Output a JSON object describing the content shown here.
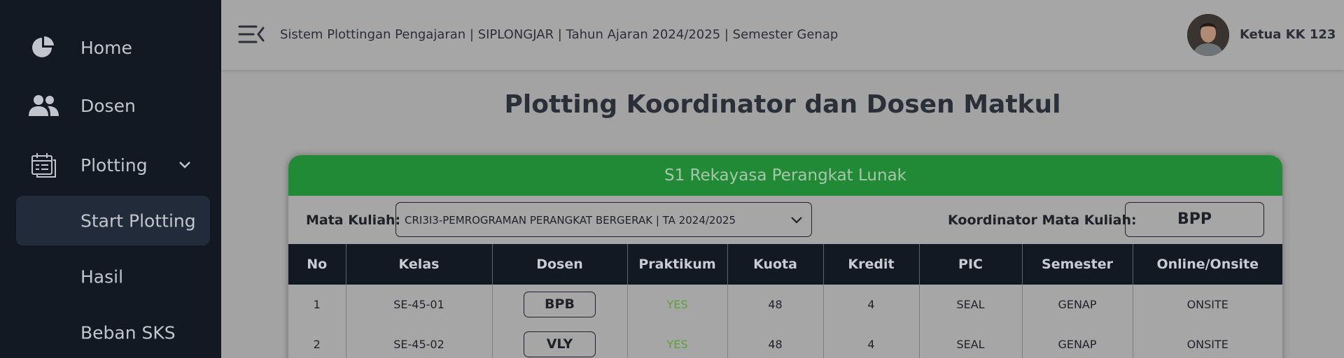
{
  "sidebar": {
    "items": [
      {
        "label": "Home",
        "icon": "pie-chart-icon"
      },
      {
        "label": "Dosen",
        "icon": "users-icon"
      },
      {
        "label": "Plotting",
        "icon": "calendar-list-icon"
      }
    ],
    "sub_items": [
      {
        "label": "Start Plotting",
        "active": true
      },
      {
        "label": "Hasil"
      },
      {
        "label": "Beban SKS"
      }
    ]
  },
  "topbar": {
    "title": "Sistem Plottingan Pengajaran | SIPLONGJAR | Tahun Ajaran 2024/2025 | Semester Genap",
    "user_name": "Ketua KK 123"
  },
  "page": {
    "title": "Plotting Koordinator dan Dosen Matkul"
  },
  "card": {
    "header": "S1 Rekayasa Perangkat Lunak",
    "mata_kuliah_label": "Mata Kuliah:",
    "mata_kuliah_value": "CRI3I3-PEMROGRAMAN PERANGKAT BERGERAK | TA 2024/2025",
    "koordinator_label": "Koordinator Mata Kuliah:",
    "koordinator_value": "BPP"
  },
  "table": {
    "headers": [
      "No",
      "Kelas",
      "Dosen",
      "Praktikum",
      "Kuota",
      "Kredit",
      "PIC",
      "Semester",
      "Online/Onsite"
    ],
    "rows": [
      {
        "no": "1",
        "kelas": "SE-45-01",
        "dosen": "BPB",
        "praktikum": "YES",
        "kuota": "48",
        "kredit": "4",
        "pic": "SEAL",
        "semester": "GENAP",
        "mode": "ONSITE"
      },
      {
        "no": "2",
        "kelas": "SE-45-02",
        "dosen": "VLY",
        "praktikum": "YES",
        "kuota": "48",
        "kredit": "4",
        "pic": "SEAL",
        "semester": "GENAP",
        "mode": "ONSITE"
      }
    ]
  },
  "colors": {
    "sidebar_bg": "#121923",
    "card_header_green": "#218a36",
    "yes_green": "#5ea13a"
  }
}
